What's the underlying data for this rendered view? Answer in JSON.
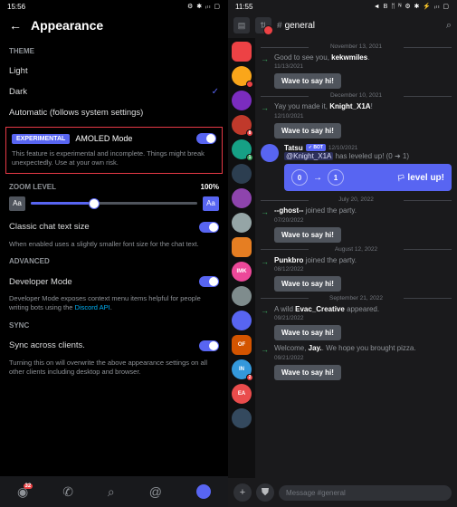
{
  "left": {
    "status_time": "15:56",
    "status_icons": "⚙ ✱ ᵢₗₗ ▢",
    "title": "Appearance",
    "sections": {
      "theme": "THEME",
      "zoom": "ZOOM LEVEL",
      "advanced": "ADVANCED",
      "sync": "SYNC"
    },
    "theme": {
      "light": "Light",
      "dark": "Dark",
      "auto": "Automatic (follows system settings)"
    },
    "exp": {
      "badge": "EXPERIMENTAL",
      "label": "AMOLED Mode",
      "desc": "This feature is experimental and incomplete. Things might break unexpectedly. Use at your own risk."
    },
    "zoom_val": "100%",
    "aa": "Aa",
    "classic": {
      "label": "Classic chat text size",
      "desc": "When enabled uses a slightly smaller font size for the chat text."
    },
    "dev": {
      "label": "Developer Mode",
      "desc_a": "Developer Mode exposes context menu items helpful for people writing bots using the ",
      "link": "Discord API",
      "desc_b": "."
    },
    "sync": {
      "label": "Sync across clients.",
      "desc": "Turning this on will overwrite the above appearance settings on all other clients including desktop and browser."
    },
    "nav_badge": "32"
  },
  "right": {
    "status_time": "11:55",
    "status_icons": "◄ B ᛖ ᴺ     ⚙ ✱ ⚡ ᵢₗₗ ▢",
    "channel": "general",
    "servers": [
      {
        "color": "#ed4245",
        "shape": "sq"
      },
      {
        "color": "#faa61a",
        "badge": ""
      },
      {
        "color": "#7b2cbf"
      },
      {
        "color": "#c0392b",
        "badge": "8"
      },
      {
        "color": "#16a085",
        "badge": "1",
        "bg": "g"
      },
      {
        "color": "#2c3e50"
      },
      {
        "color": "#8e44ad"
      },
      {
        "color": "#95a5a6"
      },
      {
        "color": "#e67e22",
        "shape": "sq"
      },
      {
        "color": "#ec4899",
        "text": "IMK"
      },
      {
        "color": "#7f8c8d"
      },
      {
        "color": "#5865f2"
      },
      {
        "color": "#d35400",
        "text": "OF",
        "shape": "sq"
      },
      {
        "color": "#3498db",
        "text": "IN",
        "badge": "2"
      },
      {
        "color": "#ea4c4c",
        "text": "EA"
      },
      {
        "color": "#34495e"
      }
    ],
    "dates": [
      "November 13, 2021",
      "December 10, 2021",
      "July 20, 2022",
      "August 12, 2022",
      "September 21, 2022"
    ],
    "msgs": {
      "m1": {
        "pre": "Good to see you, ",
        "user": "kekwmiles",
        "post": ".",
        "ts": "11/13/2021"
      },
      "m2": {
        "pre": "Yay you made it, ",
        "user": "Knight_X1A",
        "post": "!",
        "ts": "12/10/2021"
      },
      "m3": {
        "pre": "",
        "user": "--ghost--",
        "post": " joined the party.",
        "ts": "07/20/2022"
      },
      "m4": {
        "pre": "",
        "user": "Punkbro",
        "post": " joined the party.",
        "ts": "08/12/2022"
      },
      "m5": {
        "pre": "A wild ",
        "user": "Evac_Creative",
        "post": " appeared.",
        "ts": "09/21/2022"
      },
      "m6": {
        "pre": "Welcome, ",
        "user": "Jay.",
        "post": ". We hope you brought pizza.",
        "ts": "09/21/2022"
      }
    },
    "bot": {
      "name": "Tatsu",
      "tag": "✓ BOT",
      "ts": "12/10/2021",
      "mention": "@Knight_X1A",
      "txt": " has leveled up! (0 ➜ 1)",
      "lvl0": "0",
      "lvl1": "1",
      "lvltxt": "level up!"
    },
    "wave": "Wave to say hi!",
    "compose": "Message #general"
  }
}
